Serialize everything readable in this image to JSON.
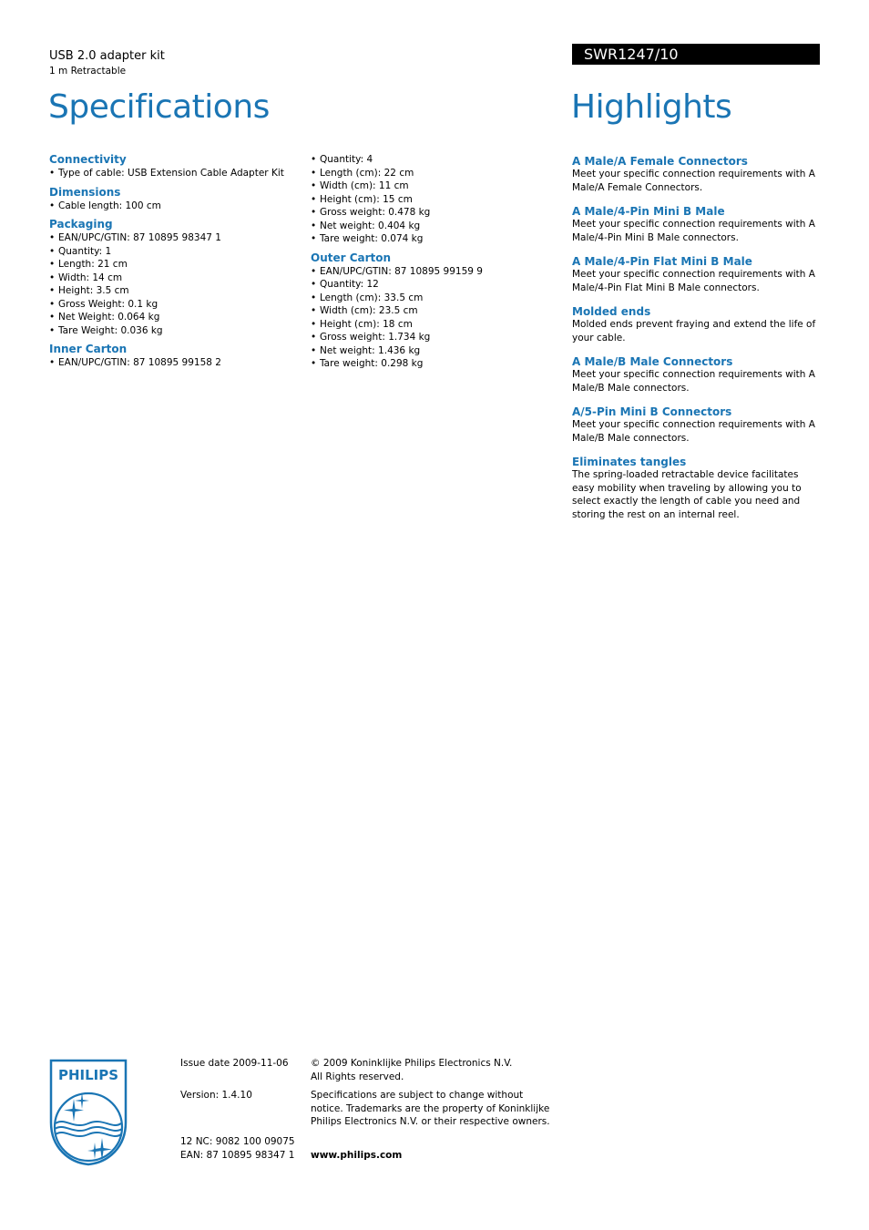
{
  "header": {
    "product_name": "USB 2.0 adapter kit",
    "product_subtitle": "1 m Retractable",
    "model_number": "SWR1247/10",
    "specifications_title": "Specifications",
    "highlights_title": "Highlights"
  },
  "specifications": {
    "column1": [
      {
        "title": "Connectivity",
        "items": [
          "Type of cable: USB Extension Cable Adapter Kit"
        ]
      },
      {
        "title": "Dimensions",
        "items": [
          "Cable length: 100 cm"
        ]
      },
      {
        "title": "Packaging",
        "items": [
          "EAN/UPC/GTIN: 87 10895 98347 1",
          "Quantity: 1",
          "Length: 21 cm",
          "Width: 14 cm",
          "Height: 3.5 cm",
          "Gross Weight: 0.1 kg",
          "Net Weight: 0.064 kg",
          "Tare Weight: 0.036 kg"
        ]
      },
      {
        "title": "Inner Carton",
        "items": [
          "EAN/UPC/GTIN: 87 10895 99158 2"
        ]
      }
    ],
    "column2_continued": [
      "Quantity: 4",
      "Length (cm): 22 cm",
      "Width (cm): 11 cm",
      "Height (cm): 15 cm",
      "Gross weight: 0.478 kg",
      "Net weight: 0.404 kg",
      "Tare weight: 0.074 kg"
    ],
    "column2": [
      {
        "title": "Outer Carton",
        "items": [
          "EAN/UPC/GTIN: 87 10895 99159 9",
          "Quantity: 12",
          "Length (cm): 33.5 cm",
          "Width (cm): 23.5 cm",
          "Height (cm): 18 cm",
          "Gross weight: 1.734 kg",
          "Net weight: 1.436 kg",
          "Tare weight: 0.298 kg"
        ]
      }
    ]
  },
  "highlights": [
    {
      "title": "A Male/A Female Connectors",
      "body": "Meet your specific connection requirements with A Male/A Female Connectors."
    },
    {
      "title": "A Male/4-Pin Mini B Male",
      "body": "Meet your specific connection requirements with A Male/4-Pin Mini B Male connectors."
    },
    {
      "title": "A Male/4-Pin Flat Mini B Male",
      "body": "Meet your specific connection requirements with A Male/4-Pin Flat Mini B Male connectors."
    },
    {
      "title": "Molded ends",
      "body": "Molded ends prevent fraying and extend the life of your cable."
    },
    {
      "title": "A Male/B Male Connectors",
      "body": "Meet your specific connection requirements with A Male/B Male connectors."
    },
    {
      "title": "A/5-Pin Mini B Connectors",
      "body": "Meet your specific connection requirements with A Male/B Male connectors."
    },
    {
      "title": "Eliminates tangles",
      "body": "The spring-loaded retractable device facilitates easy mobility when traveling by allowing you to select exactly the length of cable you need and storing the rest on an internal reel."
    }
  ],
  "footer": {
    "logo_text": "PHILIPS",
    "issue_date": "Issue date 2009-11-06",
    "copyright_line1": "© 2009 Koninklijke Philips Electronics N.V.",
    "copyright_line2": "All Rights reserved.",
    "version": "Version: 1.4.10",
    "disclaimer": "Specifications are subject to change without notice. Trademarks are the property of Koninklijke Philips Electronics N.V. or their respective owners.",
    "nc": "12 NC: 9082 100 09075",
    "ean": "EAN: 87 10895 98347 1",
    "website": "www.philips.com"
  },
  "colors": {
    "accent": "#1a75b4",
    "model_bar_bg": "#000000",
    "model_bar_text": "#ffffff"
  }
}
